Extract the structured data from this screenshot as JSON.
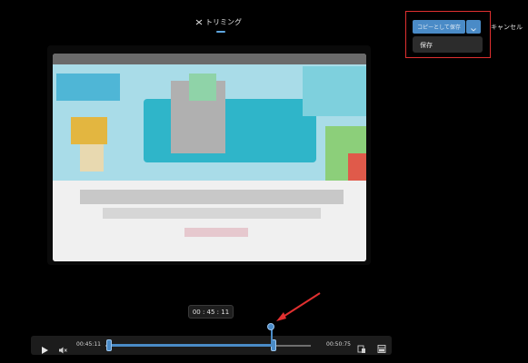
{
  "header": {
    "tab_label": "トリミング",
    "tab_icon": "trim-icon"
  },
  "actions": {
    "save_as_label": "コピーとして保存",
    "dropdown_icon": "chevron-down-icon",
    "menu_items": [
      {
        "label": "保存"
      }
    ],
    "cancel_label": "キャンセル"
  },
  "video": {
    "current_time": "00 : 45 : 11"
  },
  "controls": {
    "play_icon": "play-icon",
    "volume_icon": "mute-icon",
    "trim_start": "00:45:11",
    "trim_end": "00:50:75",
    "icons": [
      "aspect-icon",
      "film-icon"
    ]
  },
  "colors": {
    "accent": "#4a8bc7",
    "highlight": "#e03030",
    "background": "#000000"
  }
}
